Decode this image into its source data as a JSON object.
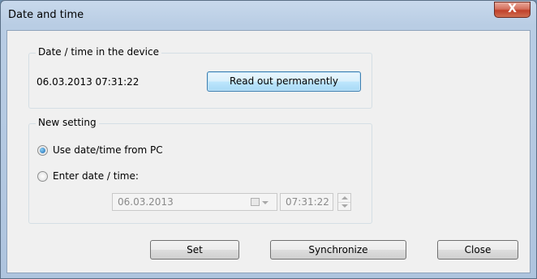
{
  "window": {
    "title": "Date and time",
    "close_glyph": "X"
  },
  "device_group": {
    "legend": "Date / time in the device",
    "datetime": "06.03.2013 07:31:22",
    "read_button": "Read out permanently"
  },
  "new_setting": {
    "legend": "New setting",
    "option_pc": "Use date/time from PC",
    "option_pc_checked": true,
    "option_enter": "Enter date / time:",
    "option_enter_checked": false,
    "date_value": "06.03.2013",
    "time_value": "07:31:22",
    "enabled": false
  },
  "buttons": {
    "set": "Set",
    "synchronize": "Synchronize",
    "close": "Close"
  },
  "icons": [
    "close-icon",
    "calendar-icon",
    "dropdown-arrow-icon",
    "spin-up-icon",
    "spin-down-icon"
  ]
}
